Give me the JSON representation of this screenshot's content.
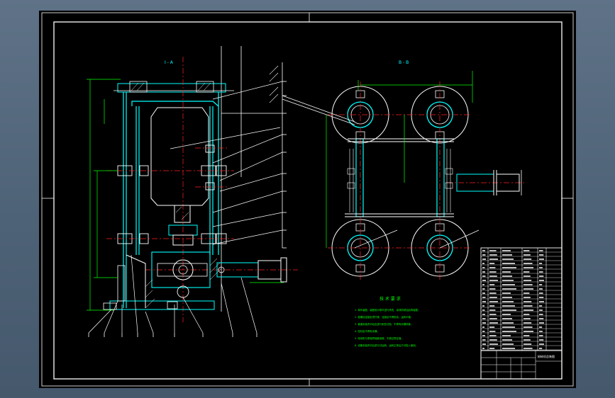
{
  "drawing": {
    "section_left": "I - A",
    "section_right": "B - B",
    "notes_title": "技 术 要 求",
    "notes": [
      "1. 零件装配，装配前对零件进行清洗，涂抹防锈油后再装配。",
      "2. 各螺纹连接处须拧紧，连接处不得松动，运转平稳。",
      "3. 管道安装完毕后应进行耐压试验，不得有渗漏现象。",
      "4. 密封处不得有渗漏。",
      "5. 电动机与泵轴同轴度误差，不超过规定值。",
      "6. 设备安装完毕后进行试运转，运转正常后方可投入使用。"
    ],
    "parts_table_title": "粉碎机总装图"
  },
  "colors": {
    "background": "#4e6277",
    "sheet": "#000000",
    "frame": "#ffffff",
    "outline": "#00ffff",
    "part": "#ffffff",
    "centerline": "#ff2020",
    "leader": "#ffffff",
    "dimension": "#00ff00",
    "hatch": "#ffffff",
    "text": "#ffffff",
    "notes": "#00ff00"
  },
  "icons": {
    "flange": "flange-icon",
    "bolt": "bolt-icon",
    "motor": "motor-icon",
    "coupling": "coupling-icon",
    "pipe": "pipe-icon"
  }
}
